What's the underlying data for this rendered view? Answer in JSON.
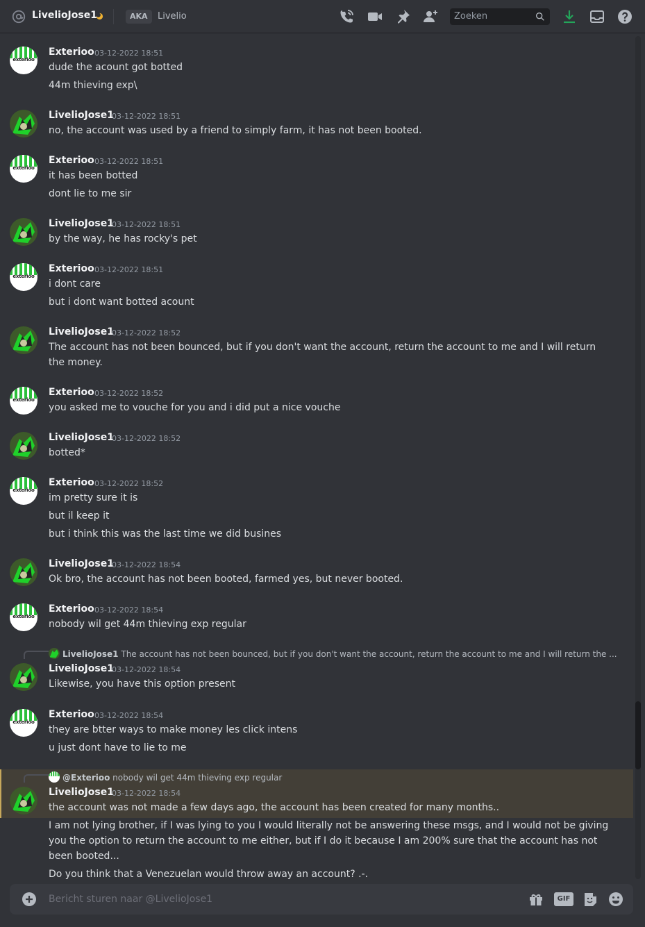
{
  "header": {
    "title": "LivelioJose1",
    "aka_label": "AKA",
    "aka_name": "Livelio",
    "search_placeholder": "Zoeken",
    "icons": [
      "at-icon",
      "moon-status-icon",
      "voice-call-icon",
      "video-call-icon",
      "pin-icon",
      "add-friend-icon",
      "search-icon",
      "download-icon",
      "inbox-icon",
      "help-icon"
    ],
    "download_color": "#23a55a"
  },
  "avatars": {
    "exterioo_brand": "exterioo"
  },
  "messages": [
    {
      "author": "Exterioo",
      "time": "03-12-2022 18:51",
      "lines": [
        "dude the acount got botted",
        "44m thieving exp\\"
      ]
    },
    {
      "author": "LivelioJose1",
      "time": "03-12-2022 18:51",
      "lines": [
        "no, the account was used by a friend to simply farm, it has not been booted."
      ]
    },
    {
      "author": "Exterioo",
      "time": "03-12-2022 18:51",
      "lines": [
        "it has been botted",
        "dont lie to me sir"
      ]
    },
    {
      "author": "LivelioJose1",
      "time": "03-12-2022 18:51",
      "lines": [
        "by the way, he has rocky's pet"
      ]
    },
    {
      "author": "Exterioo",
      "time": "03-12-2022 18:51",
      "lines": [
        "i dont care",
        "but i dont want botted acount"
      ]
    },
    {
      "author": "LivelioJose1",
      "time": "03-12-2022 18:52",
      "lines": [
        "The account has not been bounced, but if you don't want the account, return the account to me and I will return the money."
      ]
    },
    {
      "author": "Exterioo",
      "time": "03-12-2022 18:52",
      "lines": [
        "you asked me to vouche for you and i did put a nice vouche"
      ]
    },
    {
      "author": "LivelioJose1",
      "time": "03-12-2022 18:52",
      "lines": [
        "botted*"
      ]
    },
    {
      "author": "Exterioo",
      "time": "03-12-2022 18:52",
      "lines": [
        "im pretty sure it is",
        "but il keep it",
        "but i think this was the last time we did busines"
      ]
    },
    {
      "author": "LivelioJose1",
      "time": "03-12-2022 18:54",
      "lines": [
        "Ok bro, the account has not been booted, farmed yes, but never booted."
      ]
    },
    {
      "author": "Exterioo",
      "time": "03-12-2022 18:54",
      "lines": [
        "nobody wil  get 44m thieving exp regular"
      ]
    },
    {
      "author": "LivelioJose1",
      "time": "03-12-2022 18:54",
      "reply": {
        "name": "LivelioJose1",
        "text": "The account has not been bounced, but if you don't want the account, return the account to me and I will return the ..."
      },
      "lines": [
        "Likewise, you have this option present"
      ]
    },
    {
      "author": "Exterioo",
      "time": "03-12-2022 18:54",
      "lines": [
        "they are btter ways to make money les click intens",
        "u just dont have to lie to me"
      ]
    },
    {
      "author": "LivelioJose1",
      "time": "03-12-2022 18:54",
      "reply": {
        "name": "@Exterioo",
        "text": "nobody wil  get 44m thieving exp regular"
      },
      "lines": [
        "the account was not made a few days ago, the account has been created for many months..",
        "I am not lying brother, if I was lying to you I would literally not be answering these msgs, and I would not be giving you the option to return the account to me either, but if I do it because I am 200% sure that the account has not been booted...",
        "Do you think that a Venezuelan would throw away an account? .-."
      ]
    }
  ],
  "composer": {
    "placeholder": "Bericht sturen naar @LivelioJose1",
    "gif_label": "GIF",
    "icons": [
      "plus-circle-icon",
      "gift-icon",
      "gif-icon",
      "sticker-icon",
      "emoji-icon"
    ]
  },
  "colors": {
    "background": "#313338",
    "mention_highlight": "#433f37",
    "mention_border": "#c7a85c",
    "exterioo_green": "#2bbf3a"
  }
}
